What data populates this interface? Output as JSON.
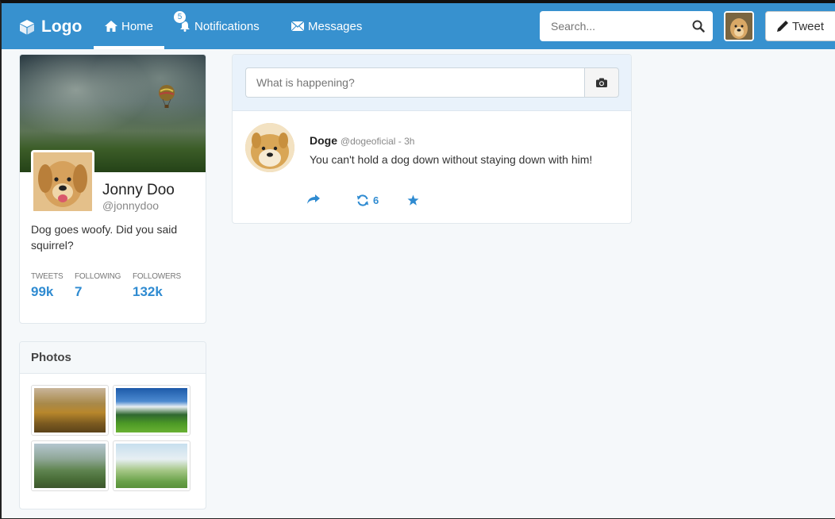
{
  "navbar": {
    "brand": "Logo",
    "home_label": "Home",
    "notifications_label": "Notifications",
    "notifications_count": "5",
    "messages_label": "Messages",
    "search_placeholder": "Search...",
    "tweet_button_label": "Tweet",
    "accent_color": "#3791cf"
  },
  "profile": {
    "name": "Jonny Doo",
    "handle": "@jonnydoo",
    "bio": "Dog goes woofy. Did you said squirrel?",
    "stats": [
      {
        "label": "TWEETS",
        "value": "99k"
      },
      {
        "label": "FOLLOWING",
        "value": "7"
      },
      {
        "label": "FOLLOWERS",
        "value": "132k"
      }
    ]
  },
  "photos": {
    "title": "Photos"
  },
  "compose": {
    "placeholder": "What is happening?"
  },
  "tweets": [
    {
      "author": "Doge",
      "handle": "@dogeoficial",
      "time": "3h",
      "separator": " - ",
      "text": "You can't hold a dog down without staying down with him!",
      "retweets": "6"
    }
  ]
}
